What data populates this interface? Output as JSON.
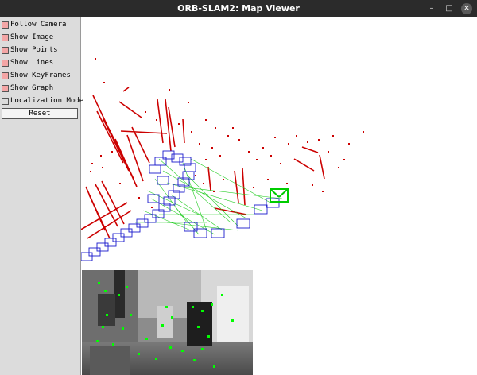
{
  "window": {
    "title": "ORB-SLAM2: Map Viewer",
    "minimize_icon": "minimize-icon",
    "maximize_icon": "maximize-icon",
    "close_icon": "close-icon"
  },
  "panel": {
    "items": [
      {
        "label": "Follow Camera",
        "checked": true
      },
      {
        "label": "Show Image",
        "checked": true
      },
      {
        "label": "Show Points",
        "checked": true
      },
      {
        "label": "Show Lines",
        "checked": true
      },
      {
        "label": "Show KeyFrames",
        "checked": true
      },
      {
        "label": "Show Graph",
        "checked": true
      },
      {
        "label": "Localization Mode",
        "checked": false
      }
    ],
    "reset_label": "Reset"
  },
  "colors": {
    "titlebar": "#2b2b2b",
    "panel": "#dcdcdc",
    "checked": "#f4a6a6",
    "map_points": "#cc0000",
    "keyframes": "#1a1acc",
    "graph": "#22cc22",
    "current_camera": "#00cc00",
    "features": "#00ff00"
  }
}
